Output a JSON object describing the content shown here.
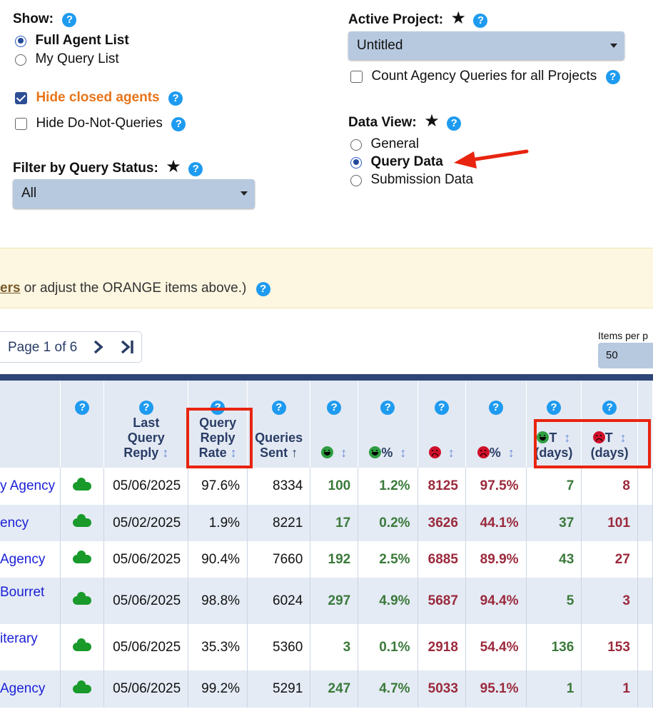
{
  "filters": {
    "show_label": "Show:",
    "show_options": [
      "Full Agent List",
      "My Query List"
    ],
    "hide_closed_label": "Hide closed agents",
    "hide_dnq_label": "Hide Do-Not-Queries",
    "filter_status_label": "Filter by Query Status:",
    "filter_status_value": "All"
  },
  "project": {
    "label": "Active Project:",
    "value": "Untitled",
    "count_all_label": "Count Agency Queries for all Projects"
  },
  "data_view": {
    "label": "Data View:",
    "options": [
      "General",
      "Query Data",
      "Submission Data"
    ]
  },
  "banner": {
    "link_text": "ers",
    "text": " or adjust the ORANGE items above.)"
  },
  "pager": {
    "text": "Page 1 of 6",
    "items_per_page_label": "Items per p",
    "items_per_page_value": "50"
  },
  "table": {
    "headers": {
      "last_reply": [
        "Last",
        "Query",
        "Reply"
      ],
      "reply_rate": [
        "Query",
        "Reply",
        "Rate"
      ],
      "queries_sent": [
        "Queries",
        "Sent"
      ],
      "pos_pct": "%",
      "neg_pct": "%",
      "pos_t": [
        "T",
        "(days)"
      ],
      "neg_t": [
        "T",
        "(days)"
      ]
    },
    "rows": [
      {
        "agency": "y Agency",
        "date": "05/06/2025",
        "rate": "97.6%",
        "sent": "8334",
        "pos": "100",
        "pos_pct": "1.2%",
        "neg": "8125",
        "neg_pct": "97.5%",
        "pos_t": "7",
        "neg_t": "8"
      },
      {
        "agency": "ency",
        "date": "05/02/2025",
        "rate": "1.9%",
        "sent": "8221",
        "pos": "17",
        "pos_pct": "0.2%",
        "neg": "3626",
        "neg_pct": "44.1%",
        "pos_t": "37",
        "neg_t": "101"
      },
      {
        "agency": "Agency",
        "date": "05/06/2025",
        "rate": "90.4%",
        "sent": "7660",
        "pos": "192",
        "pos_pct": "2.5%",
        "neg": "6885",
        "neg_pct": "89.9%",
        "pos_t": "43",
        "neg_t": "27"
      },
      {
        "agency": "Bourret",
        "date": "05/06/2025",
        "rate": "98.8%",
        "sent": "6024",
        "pos": "297",
        "pos_pct": "4.9%",
        "neg": "5687",
        "neg_pct": "94.4%",
        "pos_t": "5",
        "neg_t": "3"
      },
      {
        "agency": "iterary",
        "date": "05/06/2025",
        "rate": "35.3%",
        "sent": "5360",
        "pos": "3",
        "pos_pct": "0.1%",
        "neg": "2918",
        "neg_pct": "54.4%",
        "pos_t": "136",
        "neg_t": "153"
      },
      {
        "agency": "Agency",
        "date": "05/06/2025",
        "rate": "99.2%",
        "sent": "5291",
        "pos": "247",
        "pos_pct": "4.7%",
        "neg": "5033",
        "neg_pct": "95.1%",
        "pos_t": "1",
        "neg_t": "1"
      }
    ]
  },
  "colors": {
    "accent_orange": "#e8741a",
    "header_bar": "#2e4577",
    "highlight_red": "#e8240f",
    "positive_green": "#3b7a3b",
    "negative_red": "#9b2a3c"
  }
}
